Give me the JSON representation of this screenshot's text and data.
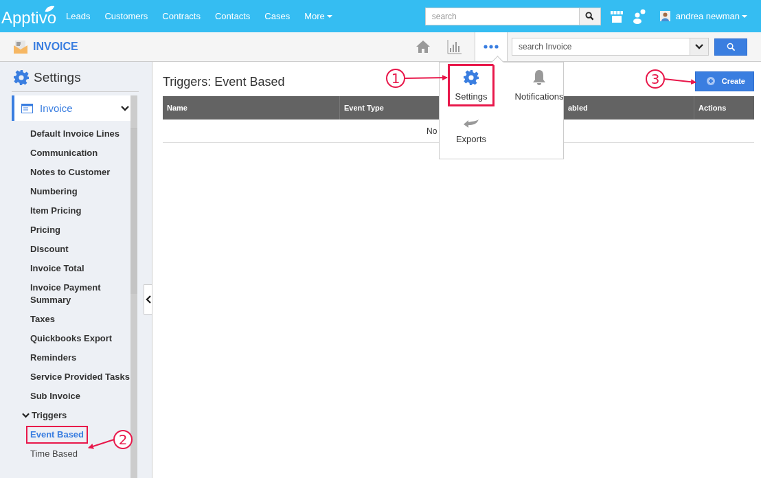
{
  "top_bar": {
    "logo": "Apptivo",
    "nav": [
      "Leads",
      "Customers",
      "Contracts",
      "Contacts",
      "Cases",
      "More"
    ],
    "search": {
      "placeholder": "search"
    },
    "user": "andrea newman"
  },
  "app_bar": {
    "title": "INVOICE",
    "tabs": [
      {
        "kind": "home",
        "selected": false
      },
      {
        "kind": "chart",
        "selected": false
      },
      {
        "kind": "more",
        "selected": true
      }
    ],
    "search": {
      "placeholder": "search Invoice"
    }
  },
  "menu": {
    "items": [
      {
        "kind": "settings",
        "label": "Settings",
        "highlighted": true
      },
      {
        "kind": "notifications",
        "label": "Notifications",
        "highlighted": false
      },
      {
        "kind": "exports",
        "label": "Exports",
        "highlighted": false
      }
    ]
  },
  "sidebar": {
    "title": "Settings",
    "section": {
      "label": "Invoice",
      "expanded": true
    },
    "items": [
      {
        "label": "Default Invoice Lines"
      },
      {
        "label": "Communication"
      },
      {
        "label": "Notes to Customer"
      },
      {
        "label": "Numbering"
      },
      {
        "label": "Item Pricing"
      },
      {
        "label": "Pricing"
      },
      {
        "label": "Discount"
      },
      {
        "label": "Invoice Total"
      },
      {
        "label": "Invoice Payment Summary"
      },
      {
        "label": "Taxes"
      },
      {
        "label": "Quickbooks Export"
      },
      {
        "label": "Reminders"
      },
      {
        "label": "Service Provided Tasks"
      },
      {
        "label": "Sub Invoice"
      },
      {
        "label": "Triggers",
        "expanded": true,
        "children": [
          {
            "label": "Event Based",
            "selected": true,
            "highlighted": true
          },
          {
            "label": "Time Based",
            "selected": false,
            "highlighted": false
          }
        ]
      }
    ]
  },
  "content": {
    "title": "Triggers: Event Based",
    "create_button": "Create",
    "table": {
      "columns": [
        "Name",
        "Event Type",
        "abled",
        "Actions"
      ],
      "empty_message": "No"
    }
  },
  "annotations": [
    {
      "number": "1"
    },
    {
      "number": "2"
    },
    {
      "number": "3"
    }
  ]
}
